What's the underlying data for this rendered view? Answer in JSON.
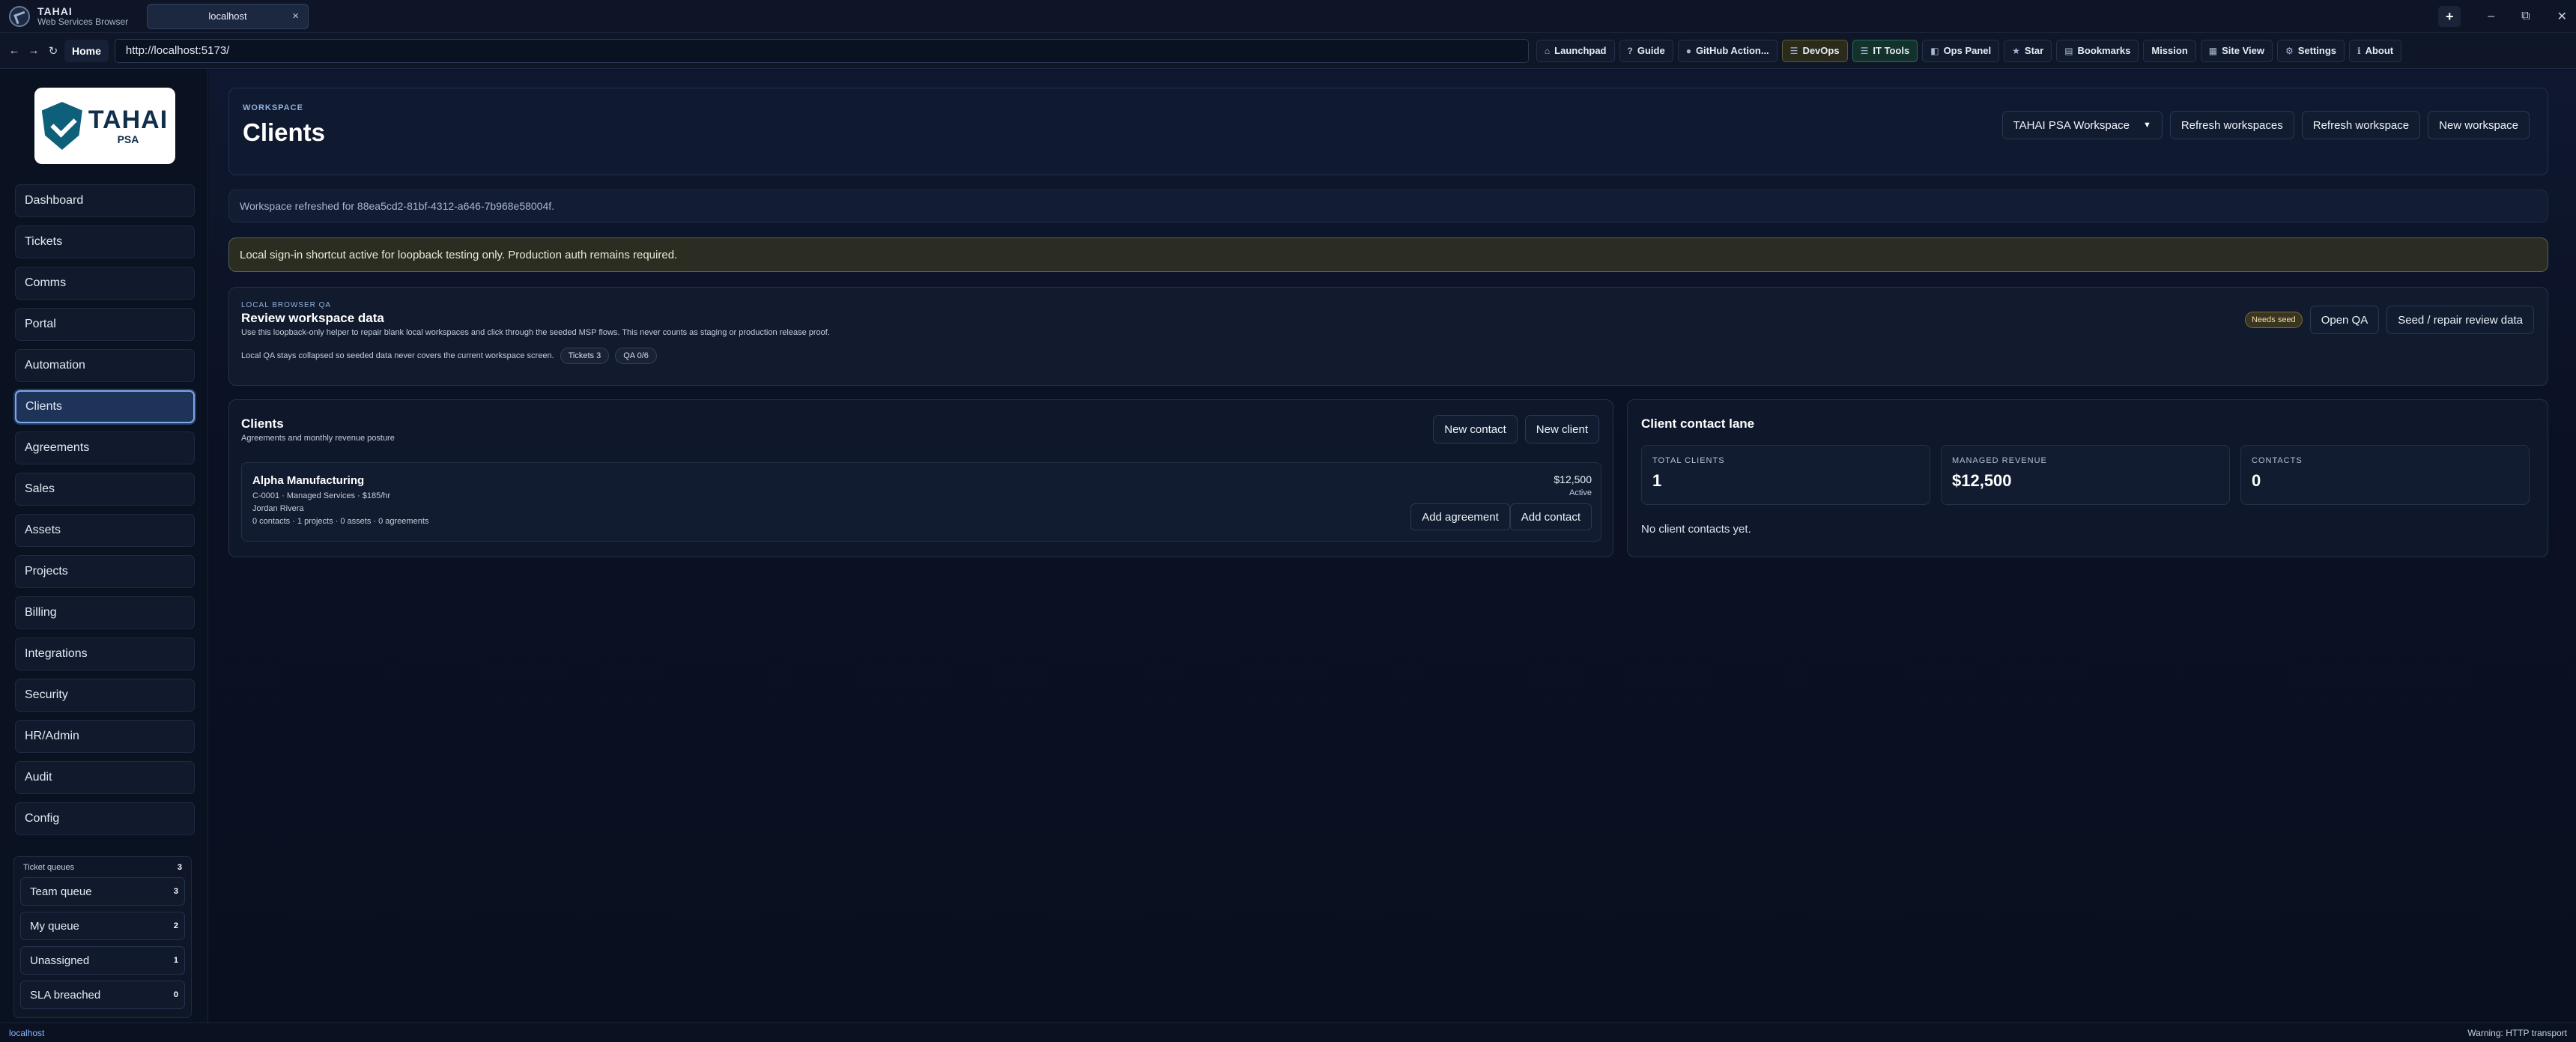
{
  "browser": {
    "brand_name": "TAHAI",
    "brand_sub": "Web Services Browser",
    "tab_title": "localhost",
    "tab_close": "×",
    "new_tab": "+",
    "win_min": "–",
    "win_restore": "⧉",
    "win_close": "✕",
    "back": "←",
    "forward": "→",
    "reload": "↻",
    "home": "Home",
    "url": "http://localhost:5173/",
    "toolbar": [
      {
        "icon": "⌂",
        "label": "Launchpad"
      },
      {
        "icon": "?",
        "label": "Guide"
      },
      {
        "icon": "●",
        "label": "GitHub Action..."
      },
      {
        "icon": "☰",
        "label": "DevOps"
      },
      {
        "icon": "☰",
        "label": "IT Tools"
      },
      {
        "icon": "◧",
        "label": "Ops Panel"
      },
      {
        "icon": "★",
        "label": "Star"
      },
      {
        "icon": "▤",
        "label": "Bookmarks"
      },
      {
        "icon": "",
        "label": "Mission"
      },
      {
        "icon": "▦",
        "label": "Site View"
      },
      {
        "icon": "⚙",
        "label": "Settings"
      },
      {
        "icon": "ℹ",
        "label": "About"
      }
    ]
  },
  "sidebar": {
    "logo_title": "TAHAI",
    "logo_sub": "PSA",
    "items": [
      "Dashboard",
      "Tickets",
      "Comms",
      "Portal",
      "Automation",
      "Clients",
      "Agreements",
      "Sales",
      "Assets",
      "Projects",
      "Billing",
      "Integrations",
      "Security",
      "HR/Admin",
      "Audit",
      "Config"
    ],
    "active": "Clients",
    "queues": {
      "title": "Ticket queues",
      "total": "3",
      "items": [
        {
          "label": "Team queue",
          "count": "3"
        },
        {
          "label": "My queue",
          "count": "2"
        },
        {
          "label": "Unassigned",
          "count": "1"
        },
        {
          "label": "SLA breached",
          "count": "0"
        }
      ]
    }
  },
  "header": {
    "eyebrow": "WORKSPACE",
    "title": "Clients",
    "workspace_select": "TAHAI PSA Workspace",
    "refresh_workspaces": "Refresh workspaces",
    "refresh_workspace": "Refresh workspace",
    "new_workspace": "New workspace"
  },
  "notice": "Workspace refreshed for 88ea5cd2-81bf-4312-a646-7b968e58004f.",
  "warning": "Local sign-in shortcut active for loopback testing only. Production auth remains required.",
  "qa": {
    "eyebrow": "LOCAL BROWSER QA",
    "title": "Review workspace data",
    "description": "Use this loopback-only helper to repair blank local workspaces and click through the seeded MSP flows. This never counts as staging or production release proof.",
    "note": "Local QA stays collapsed so seeded data never covers the current workspace screen.",
    "pill_tickets": "Tickets 3",
    "pill_qa": "QA 0/6",
    "badge": "Needs seed",
    "open_qa": "Open QA",
    "seed_repair": "Seed / repair review data"
  },
  "clients": {
    "title": "Clients",
    "subtitle": "Agreements and monthly revenue posture",
    "new_contact": "New contact",
    "new_client": "New client",
    "rows": [
      {
        "name": "Alpha Manufacturing",
        "line1": "C-0001 · Managed Services · $185/hr",
        "line2": "Jordan Rivera",
        "line3": "0 contacts · 1 projects · 0 assets · 0 agreements",
        "amount": "$12,500",
        "status": "Active",
        "add_agreement": "Add agreement",
        "add_contact": "Add contact"
      }
    ]
  },
  "contact_lane": {
    "title": "Client contact lane",
    "stats": [
      {
        "label": "TOTAL CLIENTS",
        "value": "1"
      },
      {
        "label": "MANAGED REVENUE",
        "value": "$12,500"
      },
      {
        "label": "CONTACTS",
        "value": "0"
      }
    ],
    "empty": "No client contacts yet."
  },
  "statusbar": {
    "left": "localhost",
    "right": "Warning: HTTP transport"
  }
}
